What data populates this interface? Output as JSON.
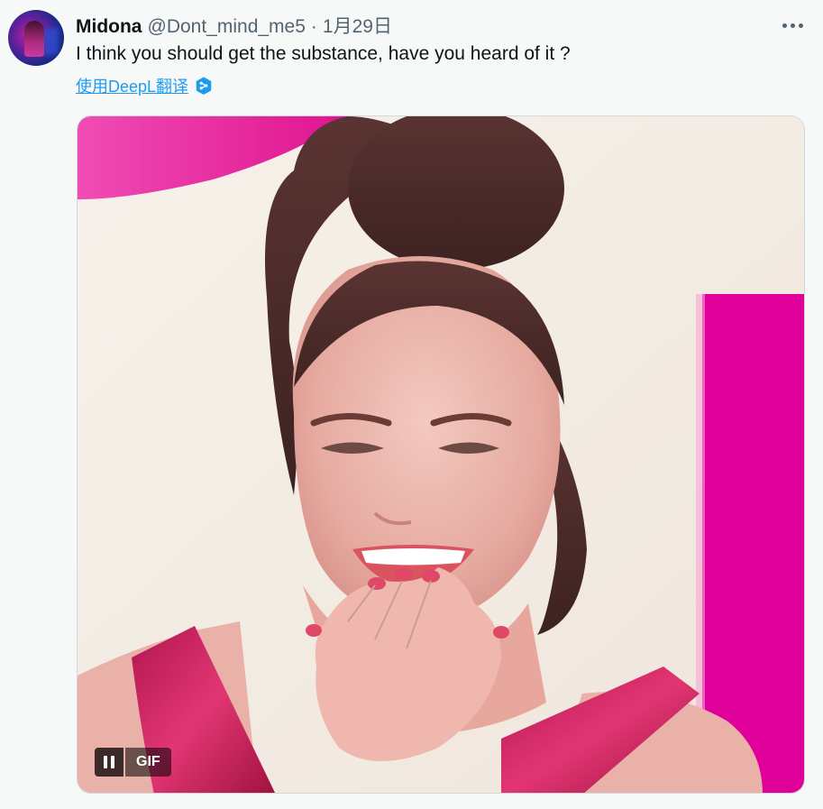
{
  "author": {
    "display_name": "Midona",
    "handle": "@Dont_mind_me5",
    "separator": "·",
    "date": "1月29日"
  },
  "tweet": {
    "text": "I think you should get the substance, have you heard of it ?",
    "translate_label": "使用DeepL翻译"
  },
  "media": {
    "type": "gif",
    "badge": "GIF",
    "pause_icon": "pause-icon"
  },
  "icons": {
    "more": "more-horizontal-icon",
    "deepl": "deepl-icon"
  },
  "colors": {
    "text": "#0f1419",
    "secondary": "#536471",
    "link": "#1d9bf0",
    "background": "#f7f9f9",
    "gif_magenta": "#e0009a"
  }
}
